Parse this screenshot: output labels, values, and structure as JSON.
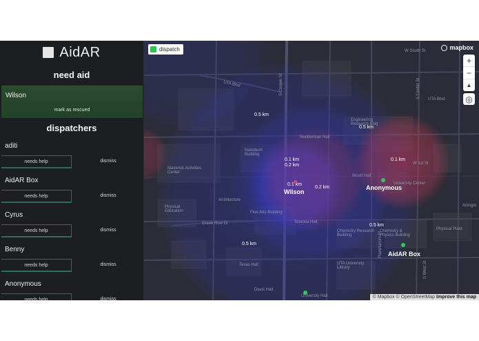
{
  "app": {
    "title": "AidAR"
  },
  "need_aid": {
    "title": "need aid",
    "items": [
      {
        "name": "Wilson",
        "action": "mark as rescued"
      }
    ]
  },
  "dispatchers": {
    "title": "dispatchers",
    "items": [
      {
        "name": "aditi",
        "help_label": "needs help",
        "dismiss_label": "dismiss"
      },
      {
        "name": "AidAR Box",
        "help_label": "needs help",
        "dismiss_label": "dismiss"
      },
      {
        "name": "Cyrus",
        "help_label": "needs help",
        "dismiss_label": "dismiss"
      },
      {
        "name": "Benny",
        "help_label": "needs help",
        "dismiss_label": "dismiss"
      },
      {
        "name": "Anonymous",
        "help_label": "needs help",
        "dismiss_label": "dismiss"
      }
    ]
  },
  "map": {
    "layer_toggle": "dispatch",
    "brand": "mapbox",
    "zoom_in": "+",
    "zoom_out": "−",
    "compass": "▲",
    "locate": "◎",
    "attribution": "© Mapbox © OpenStreetMap",
    "attribution_link": "Improve this map",
    "street_labels": {
      "uta_blvd": "UTA Blvd",
      "w_south_st": "W South St",
      "uta_blvd_right": "UTA Blvd",
      "cooper_st": "S Cooper St",
      "nedderman": "Nedderman Hall",
      "engineering": "Engineering Research Bldg",
      "nanotech": "Nanotech Building",
      "w_1st": "W 1st St",
      "maverick": "Maverick Activities Center",
      "woolf": "Woolf Hall",
      "university_center": "University Center",
      "architecture": "Architecture",
      "physical_ed": "Physical Education",
      "greek_row": "Greek Row Dr",
      "fine_arts": "Fine Arts Building",
      "science_hall": "Science Hall",
      "chem_research": "Chemistry Research Building",
      "chem_physics": "Chemistry & Physics Building",
      "physical_plant": "Physical Plant",
      "texas_hall": "Texas Hall",
      "uta_library": "UTA University Library",
      "davis_hall": "Davis Hall",
      "university_hall": "University Hall",
      "arlington": "Arlingto",
      "planetarium": "Planetarium Pl",
      "s_west": "S West St",
      "s_center": "S Center St"
    },
    "distances": {
      "d1": "0.5 km",
      "d2": "0.5 km",
      "d3": "0.1 km",
      "d4": "0.2 km",
      "d5": "0.1 km",
      "d6": "0.1 km",
      "d7": "0.2 km",
      "d8": "0.5 km",
      "d9": "0.5 km"
    },
    "markers": {
      "wilson": "Wilson",
      "anonymous": "Anonymous",
      "aidar_box": "AidAR Box"
    },
    "colors": {
      "radius_blue": "#3a3fd6",
      "radius_red": "#c23a57",
      "pin_green": "#38c45e"
    }
  }
}
